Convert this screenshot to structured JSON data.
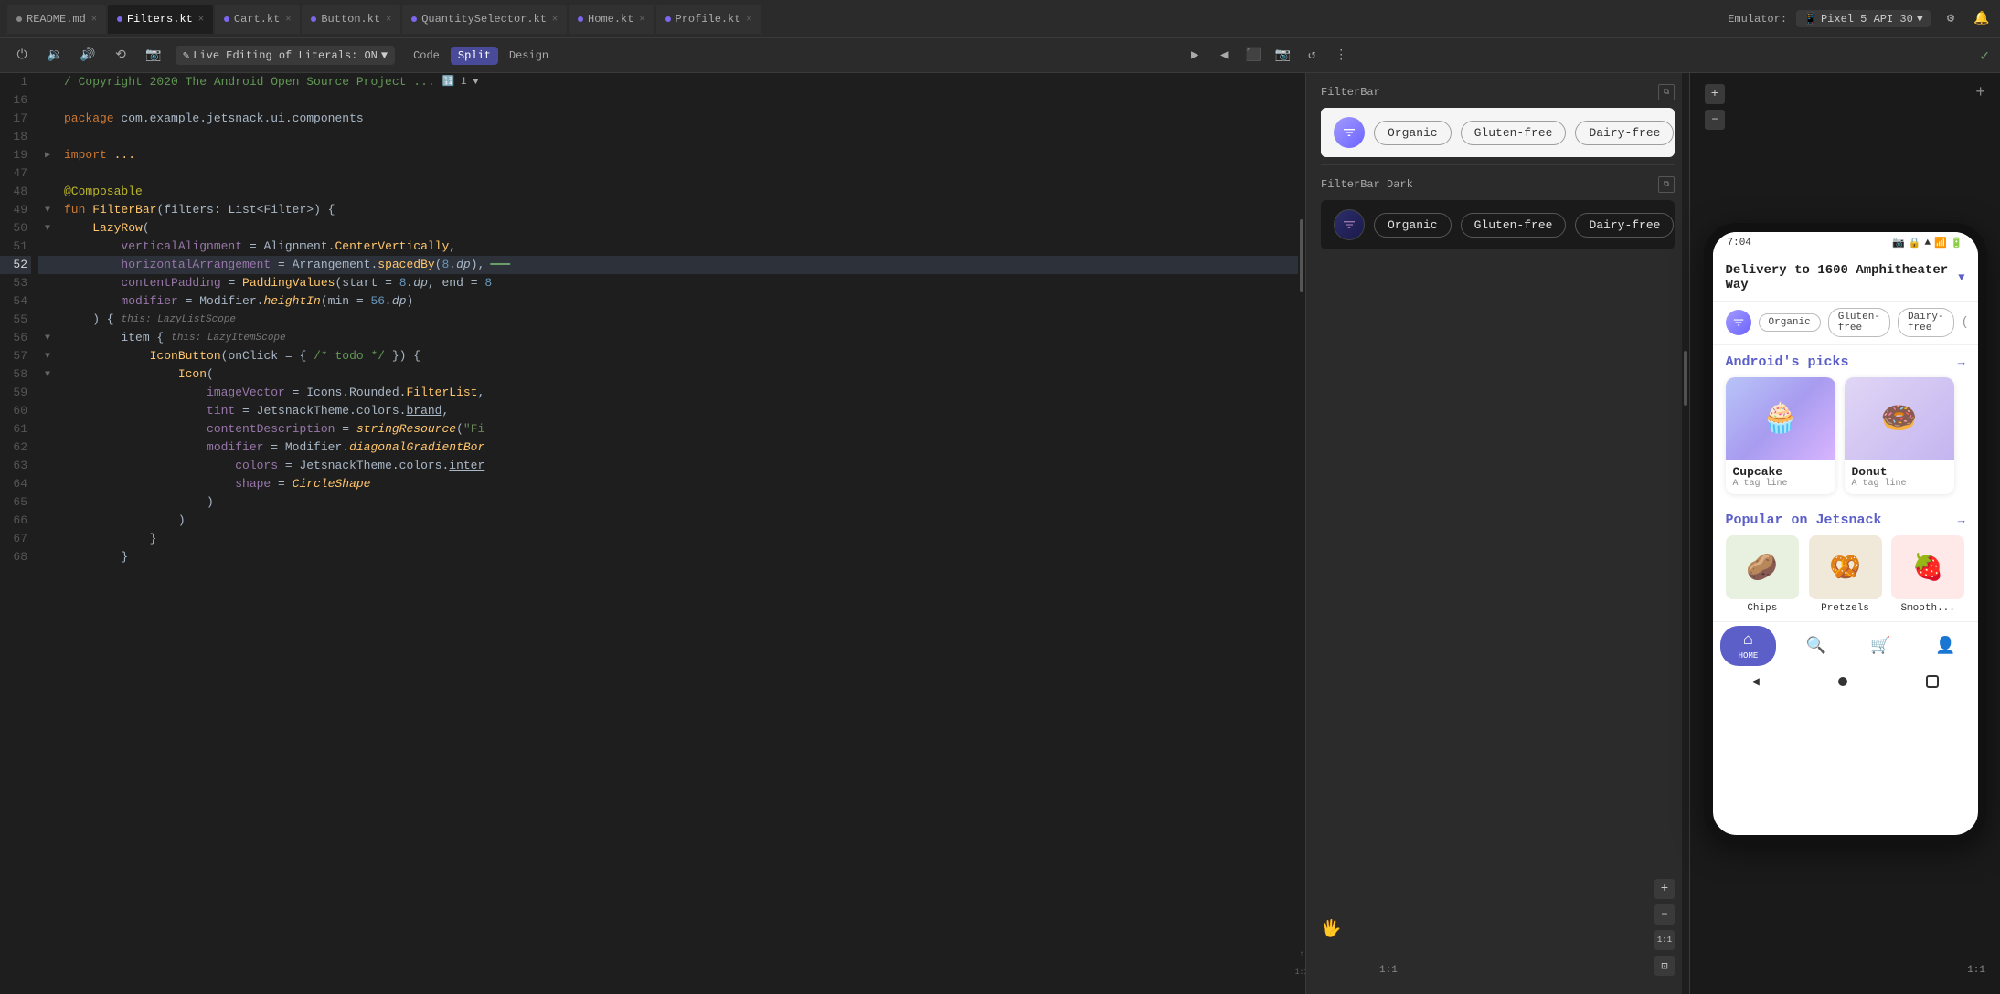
{
  "window": {
    "title": "Android Studio"
  },
  "tabs": [
    {
      "id": "readme",
      "label": "README.md",
      "type": "md",
      "active": false
    },
    {
      "id": "filters",
      "label": "Filters.kt",
      "type": "kotlin",
      "active": true
    },
    {
      "id": "cart",
      "label": "Cart.kt",
      "type": "kotlin",
      "active": false
    },
    {
      "id": "button",
      "label": "Button.kt",
      "type": "kotlin",
      "active": false
    },
    {
      "id": "quantity",
      "label": "QuantitySelector.kt",
      "type": "kotlin",
      "active": false
    },
    {
      "id": "home",
      "label": "Home.kt",
      "type": "kotlin",
      "active": false
    },
    {
      "id": "profile",
      "label": "Profile.kt",
      "type": "kotlin",
      "active": false
    }
  ],
  "toolbar": {
    "live_editing": "Live Editing of Literals: ON",
    "code_label": "Code",
    "split_label": "Split",
    "design_label": "Design"
  },
  "emulator": {
    "label": "Emulator:",
    "device": "Pixel 5 API 30"
  },
  "code": {
    "lines": [
      {
        "num": 1,
        "content": "/ Copyright 2020 The Android Open Source Project ...",
        "color": "comment"
      },
      {
        "num": 16,
        "content": "",
        "color": "normal"
      },
      {
        "num": 17,
        "content": "package com.example.jetsnack.ui.components",
        "color": "mixed"
      },
      {
        "num": 18,
        "content": "",
        "color": "normal"
      },
      {
        "num": 19,
        "content": "import ...",
        "color": "mixed"
      },
      {
        "num": 47,
        "content": "",
        "color": "normal"
      },
      {
        "num": 48,
        "content": "@Composable",
        "color": "annotation"
      },
      {
        "num": 49,
        "content": "fun FilterBar(filters: List<Filter>) {",
        "color": "mixed"
      },
      {
        "num": 50,
        "content": "    LazyRow(",
        "color": "mixed"
      },
      {
        "num": 51,
        "content": "        verticalAlignment = Alignment.CenterVertically,",
        "color": "mixed"
      },
      {
        "num": 52,
        "content": "        horizontalArrangement = Arrangement.spacedBy(8.dp),",
        "color": "mixed",
        "active": true
      },
      {
        "num": 53,
        "content": "        contentPadding = PaddingValues(start = 8.dp, end = 8",
        "color": "mixed"
      },
      {
        "num": 54,
        "content": "        modifier = Modifier.heightIn(min = 56.dp)",
        "color": "mixed"
      },
      {
        "num": 55,
        "content": "    ) {",
        "color": "mixed"
      },
      {
        "num": 56,
        "content": "        item {",
        "color": "mixed"
      },
      {
        "num": 57,
        "content": "            IconButton(onClick = { /* todo */ }) {",
        "color": "mixed"
      },
      {
        "num": 58,
        "content": "                Icon(",
        "color": "mixed"
      },
      {
        "num": 59,
        "content": "                    imageVector = Icons.Rounded.FilterList,",
        "color": "mixed"
      },
      {
        "num": 60,
        "content": "                    tint = JetsnackTheme.colors.brand,",
        "color": "mixed"
      },
      {
        "num": 61,
        "content": "                    contentDescription = stringResource(\"Fi",
        "color": "mixed"
      },
      {
        "num": 62,
        "content": "                    modifier = Modifier.diagonalGradientBor",
        "color": "mixed"
      },
      {
        "num": 63,
        "content": "                        colors = JetsnackTheme.colors.inter",
        "color": "mixed"
      },
      {
        "num": 64,
        "content": "                        shape = CircleShape",
        "color": "mixed"
      },
      {
        "num": 65,
        "content": "                    )",
        "color": "normal"
      },
      {
        "num": 66,
        "content": "                )",
        "color": "normal"
      },
      {
        "num": 67,
        "content": "            }",
        "color": "normal"
      },
      {
        "num": 68,
        "content": "        }",
        "color": "normal"
      }
    ]
  },
  "previews": [
    {
      "id": "filterbar-light",
      "label": "FilterBar",
      "theme": "light",
      "chips": [
        "Organic",
        "Gluten-free",
        "Dairy-free"
      ]
    },
    {
      "id": "filterbar-dark",
      "label": "FilterBar Dark",
      "theme": "dark",
      "chips": [
        "Organic",
        "Gluten-free",
        "Dairy-free"
      ]
    }
  ],
  "phone": {
    "time": "7:04",
    "delivery_address": "Delivery to 1600 Amphitheater Way",
    "filter_chips": [
      "Organic",
      "Gluten-free",
      "Dairy-free"
    ],
    "sections": [
      {
        "id": "androids-picks",
        "title": "Android's picks",
        "items": [
          {
            "name": "Cupcake",
            "tag": "A tag line",
            "emoji": "🧁",
            "bg": "cupcake"
          },
          {
            "name": "Donut",
            "tag": "A tag line",
            "emoji": "🍩",
            "bg": "donut"
          }
        ]
      },
      {
        "id": "popular",
        "title": "Popular on Jetsnack",
        "items": [
          {
            "name": "Chips",
            "emoji": "🥔",
            "bg": "chips"
          },
          {
            "name": "Pretzels",
            "emoji": "🥨",
            "bg": "pretzels"
          },
          {
            "name": "Smooth...",
            "emoji": "🍓",
            "bg": "smooth"
          }
        ]
      }
    ],
    "nav": {
      "items": [
        {
          "id": "home",
          "label": "HOME",
          "icon": "⌂",
          "active": true
        },
        {
          "id": "search",
          "label": "",
          "icon": "🔍",
          "active": false
        },
        {
          "id": "cart",
          "label": "",
          "icon": "🛒",
          "active": false
        },
        {
          "id": "profile",
          "label": "",
          "icon": "👤",
          "active": false
        }
      ]
    }
  }
}
